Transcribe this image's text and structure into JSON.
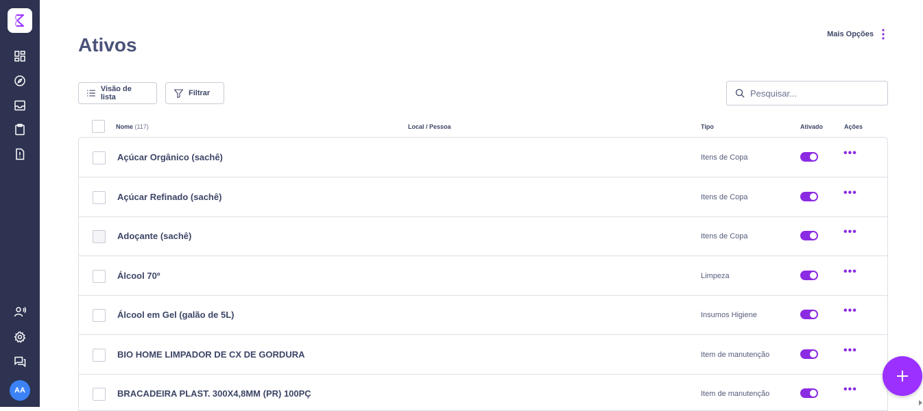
{
  "app": {
    "accent": "#8b2be2",
    "sidebar_bg": "#2d3350"
  },
  "sidebar": {
    "items": [
      {
        "icon": "dashboard-icon"
      },
      {
        "icon": "compass-icon"
      },
      {
        "icon": "inbox-icon"
      },
      {
        "icon": "clipboard-icon"
      },
      {
        "icon": "report-icon"
      }
    ],
    "bottom": [
      {
        "icon": "users-icon"
      },
      {
        "icon": "gear-icon"
      },
      {
        "icon": "chat-icon"
      }
    ],
    "avatar": "AA"
  },
  "header": {
    "title": "Ativos",
    "more_options": "Mais Opções"
  },
  "toolbar": {
    "list_view": "Visão de lista",
    "filter": "Filtrar",
    "search_placeholder": "Pesquisar..."
  },
  "table": {
    "columns": {
      "name": "Nome",
      "count": "(117)",
      "location": "Local / Pessoa",
      "type": "Tipo",
      "active": "Ativado",
      "actions": "Ações"
    },
    "rows": [
      {
        "name": "Açúcar Orgânico (sachê)",
        "type": "Itens de Copa",
        "active": true
      },
      {
        "name": "Açúcar Refinado (sachê)",
        "type": "Itens de Copa",
        "active": true
      },
      {
        "name": "Adoçante (sachê)",
        "type": "Itens de Copa",
        "active": true
      },
      {
        "name": "Álcool 70º",
        "type": "Limpeza",
        "active": true
      },
      {
        "name": "Álcool em Gel (galão de 5L)",
        "type": "Insumos Higiene",
        "active": true
      },
      {
        "name": "BIO HOME LIMPADOR DE CX DE GORDURA",
        "type": "Item de manutenção",
        "active": true
      },
      {
        "name": "BRACADEIRA PLAST. 300X4,8MM (PR) 100PÇ",
        "type": "Item de manutenção",
        "active": true
      }
    ],
    "actions_glyph": "•••"
  }
}
